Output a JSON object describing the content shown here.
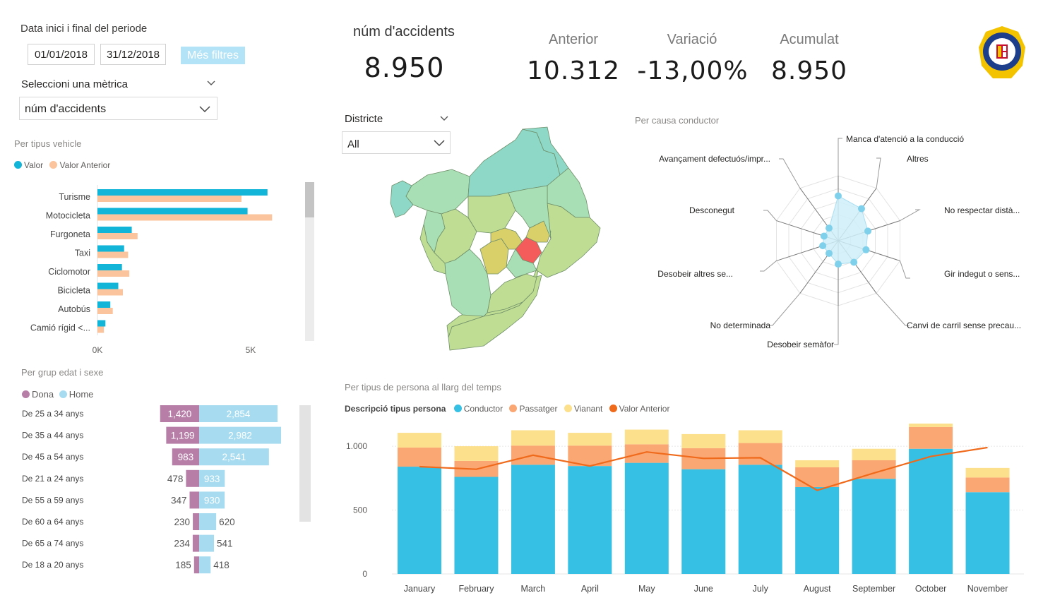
{
  "filters": {
    "period_label": "Data inici i final del periode",
    "start_date": "01/01/2018",
    "end_date": "31/12/2018",
    "more_filters": "Més filtres",
    "metric_label": "Seleccioni una mètrica",
    "metric_value": "núm d'accidents"
  },
  "kpi": {
    "main_label": "núm d'accidents",
    "main_value": "8.950",
    "anterior_label": "Anterior",
    "anterior_value": "10.312",
    "variacio_label": "Variació",
    "variacio_value": "-13,00%",
    "acumulat_label": "Acumulat",
    "acumulat_value": "8.950"
  },
  "district": {
    "label": "Districte",
    "value": "All"
  },
  "colors": {
    "valor": "#12b5d8",
    "valor_anterior": "#fbc49c",
    "dona": "#b77fa8",
    "home": "#a7dcf0",
    "conductor": "#36c0e4",
    "passatger": "#fba774",
    "vianant": "#fde08b",
    "line": "#f06a1c",
    "map_highlight": "#f45c5c",
    "radar": "#7fd0ea"
  },
  "icons": {
    "dropdown": "chevron-down-icon",
    "logo": "guardia-urbana-badge-icon"
  },
  "vehicle_chart": {
    "title": "Per tipus vehicle",
    "legend": [
      "Valor",
      "Valor Anterior"
    ],
    "type": "bar",
    "categories": [
      "Turisme",
      "Motocicleta",
      "Furgoneta",
      "Taxi",
      "Ciclomotor",
      "Bicicleta",
      "Autobús",
      "Camió rígid <..."
    ],
    "series": [
      {
        "name": "Valor",
        "values": [
          5550,
          4900,
          1120,
          870,
          800,
          680,
          420,
          260
        ]
      },
      {
        "name": "Valor Anterior",
        "values": [
          4700,
          5700,
          1310,
          1000,
          1040,
          830,
          500,
          210
        ]
      }
    ],
    "xticks": [
      "0K",
      "5K"
    ],
    "xlim": [
      0,
      6500
    ]
  },
  "age_chart": {
    "title": "Per grup edat i sexe",
    "legend": [
      "Dona",
      "Home"
    ],
    "categories": [
      "De 25 a 34 anys",
      "De 35 a 44 anys",
      "De 45 a 54 anys",
      "De 21 a 24 anys",
      "De 55 a 59 anys",
      "De 60 a 64 anys",
      "De 65 a 74 anys",
      "De 18 a 20 anys"
    ],
    "dona": [
      1420,
      1199,
      983,
      478,
      347,
      230,
      234,
      185
    ],
    "dona_labels": [
      "1,420",
      "1,199",
      "983",
      "478",
      "347",
      "230",
      "234",
      "185"
    ],
    "home": [
      2854,
      2982,
      2541,
      933,
      930,
      620,
      541,
      418
    ],
    "home_labels": [
      "2,854",
      "2,982",
      "2,541",
      "933",
      "930",
      "620",
      "541",
      "418"
    ]
  },
  "radar_chart": {
    "title": "Per causa conductor",
    "categories": [
      "Manca d'atenció a la conducció",
      "Altres",
      "No respectar distà...",
      "Gir indegut o sens...",
      "Canvi de carril sense precau...",
      "Desobeir semàfor",
      "No determinada",
      "Desobeir altres se...",
      "Desconegut",
      "Avançament defectuós/impr..."
    ],
    "values": [
      0.69,
      0.61,
      0.48,
      0.45,
      0.41,
      0.36,
      0.24,
      0.25,
      0.23,
      0.24
    ]
  },
  "chart_data": {
    "type": "bar",
    "title": "Per tipus de persona al llarg del temps",
    "legend_title": "Descripció tipus persona",
    "categories": [
      "January",
      "February",
      "March",
      "April",
      "May",
      "June",
      "July",
      "August",
      "September",
      "October",
      "November"
    ],
    "series": [
      {
        "name": "Conductor",
        "values": [
          840,
          760,
          855,
          845,
          870,
          820,
          855,
          680,
          745,
          980,
          640
        ]
      },
      {
        "name": "Passatger",
        "values": [
          150,
          125,
          150,
          160,
          145,
          165,
          170,
          155,
          145,
          170,
          115
        ]
      },
      {
        "name": "Vianant",
        "values": [
          115,
          115,
          120,
          100,
          115,
          110,
          100,
          55,
          90,
          110,
          75
        ]
      },
      {
        "name": "Valor Anterior",
        "values": [
          840,
          820,
          930,
          845,
          955,
          905,
          910,
          655,
          790,
          920,
          990
        ]
      }
    ],
    "yticks": [
      "0",
      "500",
      "1.000"
    ],
    "ylim": [
      0,
      1100
    ]
  }
}
